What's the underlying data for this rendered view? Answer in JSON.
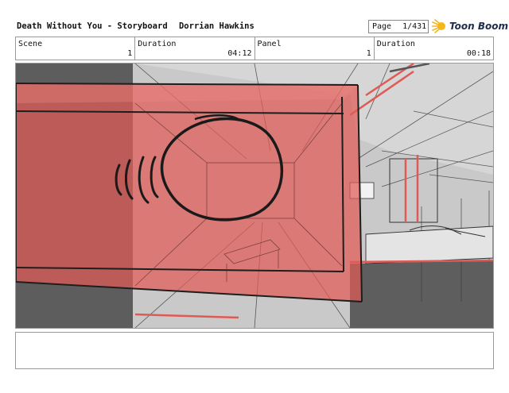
{
  "header": {
    "title": "Death Without You - Storyboard",
    "author": "Dorrian Hawkins",
    "page_label": "Page",
    "page_number": "1/431",
    "logo_text": "Toon Boom"
  },
  "info": {
    "scene_label": "Scene",
    "scene_value": "1",
    "scene_duration_label": "Duration",
    "scene_duration_value": "04:12",
    "panel_label": "Panel",
    "panel_value": "1",
    "panel_duration_label": "Duration",
    "panel_duration_value": "00:18"
  },
  "colors": {
    "overlay_red": "#e05a55",
    "sketch_line": "#222222",
    "background_gray": "#c8c8c8",
    "dark_gray": "#5e5e5e",
    "logo_sun": "#f3b71b"
  }
}
